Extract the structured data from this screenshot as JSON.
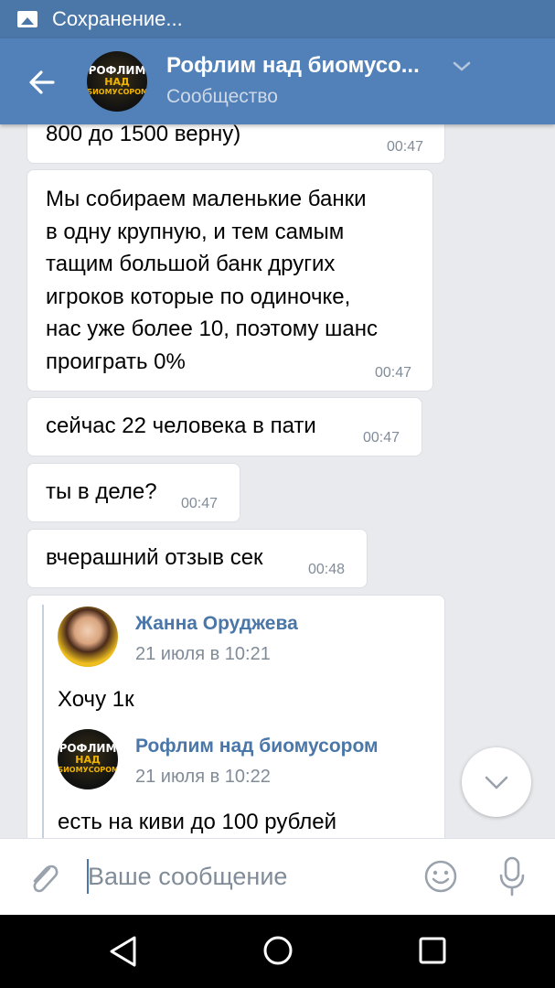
{
  "status_bar": {
    "text": "Сохранение...",
    "icon": "image-icon"
  },
  "header": {
    "title": "Рофлим над биомусо...",
    "subtitle": "Сообщество",
    "logo_lines": [
      "РОФЛИМ",
      "НАД",
      "БИОМУСОРОМ"
    ]
  },
  "messages": [
    {
      "text": "800 до 1500 верну)",
      "time": "00:47"
    },
    {
      "lines": [
        "Мы собираем маленькие банки",
        "в одну крупную, и тем самым",
        "тащим большой банк других",
        "игроков которые по одиночке,",
        "нас уже более 10, поэтому шанс",
        "проиграть 0%"
      ],
      "time": "00:47"
    },
    {
      "text": "сейчас 22 человека в пати",
      "time": "00:47"
    },
    {
      "text": "ты в деле?",
      "time": "00:47"
    },
    {
      "text": "вчерашний отзыв сек",
      "time": "00:48"
    }
  ],
  "forwarded": [
    {
      "author": "Жанна Оруджева",
      "date": "21 июля в 10:21",
      "text": "Хочу 1к"
    },
    {
      "author": "Рофлим над биомусором",
      "date": "21 июля в 10:22",
      "text": "есть на киви до 100 рублей"
    }
  ],
  "composer": {
    "placeholder": "Ваше сообщение"
  },
  "colors": {
    "accent": "#5181b8",
    "status_bar": "#4a76a8",
    "link": "#4a76a8",
    "time": "#818c99",
    "background": "#e8eaed"
  }
}
